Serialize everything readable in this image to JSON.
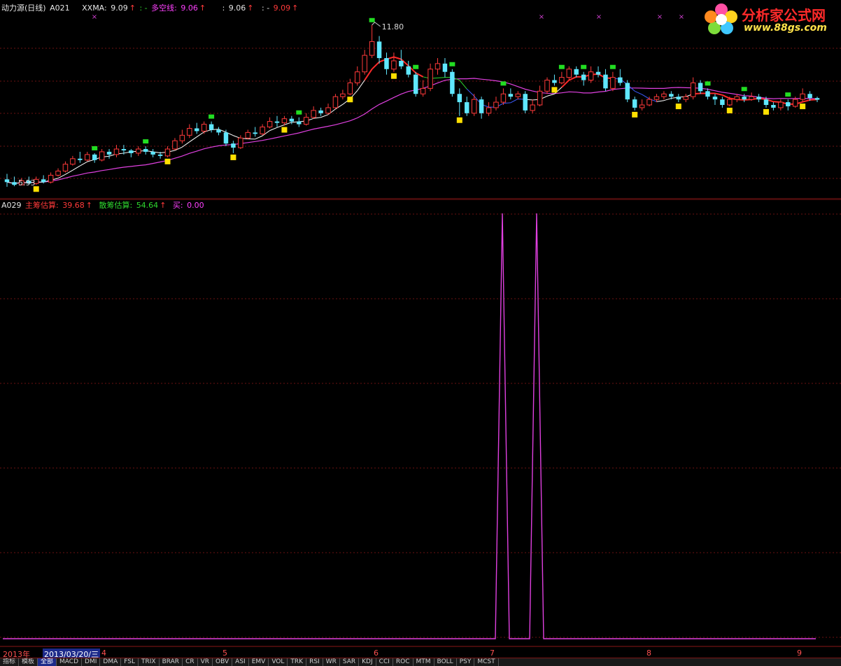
{
  "upper_panel": {
    "name": "动力源(日线)",
    "code": "A021",
    "xxma_label": "XXMA:",
    "xxma_value": "9.09",
    "sep1": ": -",
    "duokong_label": "多空线:",
    "duokong_value": "9.06",
    "val2_prefix": ":",
    "val2": "9.06",
    "val3_prefix": ": -",
    "val3": "9.09",
    "high_label": "11.80",
    "low_label": "5.93"
  },
  "lower_panel": {
    "code": "A029",
    "zhuchou_label": "主筹估算:",
    "zhuchou_value": "39.68",
    "sanchou_label": "散筹估算:",
    "sanchou_value": "54.64",
    "mai_label": "买:",
    "mai_value": "0.00"
  },
  "date_axis": {
    "year": "2013年",
    "current_date": "2013/03/20/三",
    "months": [
      "4",
      "5",
      "6",
      "7",
      "8",
      "9"
    ]
  },
  "bottom_tabs": [
    "指标",
    "模板",
    "全部",
    "MACD",
    "DMI",
    "DMA",
    "FSL",
    "TRIX",
    "BRAR",
    "CR",
    "VR",
    "OBV",
    "ASI",
    "EMV",
    "VOL",
    "TRK",
    "RSI",
    "WR",
    "SAR",
    "KDJ",
    "CCI",
    "ROC",
    "MTM",
    "BOLL",
    "PSY",
    "MCST"
  ],
  "logo": {
    "text": "分析家公式网",
    "url": "www.88gs.com"
  },
  "colors": {
    "up": "#ff3a3a",
    "down": "#5fe7ff",
    "ma_white": "#ffffff",
    "ma_magenta": "#e040e0",
    "grid": "#6b1212",
    "signal_buy": "#ffe000",
    "signal_sell": "#22dd22",
    "pulse": "#e040e0"
  },
  "chart_data": {
    "type": "candlestick",
    "price_range": [
      5.6,
      12.2
    ],
    "price_high": 11.8,
    "price_low": 5.93,
    "candles": [
      [
        6.2,
        6.1,
        6.4,
        5.93
      ],
      [
        6.1,
        6.0,
        6.3,
        5.95
      ],
      [
        6.0,
        6.15,
        6.25,
        5.98
      ],
      [
        6.15,
        6.05,
        6.3,
        6.0
      ],
      [
        6.05,
        6.2,
        6.3,
        6.0
      ],
      [
        6.2,
        6.1,
        6.35,
        6.05
      ],
      [
        6.1,
        6.35,
        6.45,
        6.05
      ],
      [
        6.35,
        6.5,
        6.6,
        6.3
      ],
      [
        6.5,
        6.75,
        6.85,
        6.45
      ],
      [
        6.75,
        6.95,
        7.05,
        6.7
      ],
      [
        6.95,
        6.9,
        7.2,
        6.8
      ],
      [
        6.9,
        7.1,
        7.2,
        6.85
      ],
      [
        7.1,
        6.9,
        7.15,
        6.8
      ],
      [
        6.9,
        7.2,
        7.3,
        6.85
      ],
      [
        7.2,
        7.1,
        7.3,
        6.95
      ],
      [
        7.1,
        7.3,
        7.45,
        7.0
      ],
      [
        7.3,
        7.25,
        7.45,
        7.1
      ],
      [
        7.25,
        7.15,
        7.3,
        7.0
      ],
      [
        7.15,
        7.3,
        7.4,
        7.05
      ],
      [
        7.3,
        7.2,
        7.4,
        7.1
      ],
      [
        7.2,
        7.1,
        7.3,
        7.0
      ],
      [
        7.1,
        7.05,
        7.2,
        6.95
      ],
      [
        7.05,
        7.3,
        7.4,
        7.0
      ],
      [
        7.3,
        7.6,
        7.7,
        7.25
      ],
      [
        7.6,
        7.8,
        8.0,
        7.5
      ],
      [
        7.8,
        8.05,
        8.2,
        7.7
      ],
      [
        8.05,
        7.95,
        8.25,
        7.85
      ],
      [
        7.95,
        8.2,
        8.3,
        7.85
      ],
      [
        8.2,
        8.0,
        8.3,
        7.9
      ],
      [
        8.0,
        7.9,
        8.1,
        7.8
      ],
      [
        7.9,
        7.5,
        8.0,
        7.4
      ],
      [
        7.5,
        7.35,
        7.6,
        7.15
      ],
      [
        7.35,
        7.7,
        7.8,
        7.3
      ],
      [
        7.7,
        7.9,
        8.0,
        7.65
      ],
      [
        7.9,
        7.85,
        8.1,
        7.75
      ],
      [
        7.85,
        8.1,
        8.2,
        7.8
      ],
      [
        8.1,
        8.3,
        8.45,
        8.05
      ],
      [
        8.3,
        8.25,
        8.5,
        8.1
      ],
      [
        8.25,
        8.4,
        8.5,
        8.15
      ],
      [
        8.4,
        8.3,
        8.5,
        8.2
      ],
      [
        8.3,
        8.2,
        8.45,
        8.1
      ],
      [
        8.2,
        8.45,
        8.6,
        8.15
      ],
      [
        8.45,
        8.7,
        8.85,
        8.4
      ],
      [
        8.7,
        8.6,
        8.8,
        8.5
      ],
      [
        8.6,
        8.8,
        8.95,
        8.55
      ],
      [
        8.8,
        9.2,
        9.3,
        8.75
      ],
      [
        9.2,
        9.3,
        9.45,
        9.1
      ],
      [
        9.3,
        9.7,
        9.85,
        9.25
      ],
      [
        9.7,
        10.1,
        10.3,
        9.6
      ],
      [
        10.1,
        10.7,
        10.9,
        10.0
      ],
      [
        10.7,
        11.2,
        11.8,
        10.6
      ],
      [
        11.2,
        10.6,
        11.4,
        10.4
      ],
      [
        10.6,
        10.2,
        10.8,
        10.0
      ],
      [
        10.2,
        10.5,
        10.8,
        10.1
      ],
      [
        10.5,
        10.3,
        10.9,
        10.2
      ],
      [
        10.3,
        10.0,
        10.5,
        9.9
      ],
      [
        10.0,
        9.3,
        10.1,
        9.2
      ],
      [
        9.3,
        9.5,
        9.8,
        9.2
      ],
      [
        9.5,
        10.2,
        10.4,
        9.4
      ],
      [
        10.2,
        10.4,
        10.6,
        10.0
      ],
      [
        10.4,
        10.1,
        10.6,
        9.9
      ],
      [
        10.1,
        9.3,
        10.2,
        9.2
      ],
      [
        9.3,
        9.0,
        9.5,
        8.5
      ],
      [
        9.0,
        8.6,
        9.2,
        8.5
      ],
      [
        8.6,
        9.1,
        9.3,
        8.5
      ],
      [
        9.1,
        8.6,
        9.2,
        8.4
      ],
      [
        8.6,
        8.8,
        9.0,
        8.5
      ],
      [
        8.8,
        9.0,
        9.2,
        8.7
      ],
      [
        9.0,
        9.3,
        9.5,
        8.9
      ],
      [
        9.3,
        9.2,
        9.5,
        9.1
      ],
      [
        9.2,
        9.3,
        9.4,
        9.1
      ],
      [
        9.3,
        8.7,
        9.4,
        8.6
      ],
      [
        8.7,
        8.9,
        9.1,
        8.6
      ],
      [
        8.9,
        9.4,
        9.6,
        8.85
      ],
      [
        9.4,
        9.8,
        9.9,
        9.3
      ],
      [
        9.8,
        9.7,
        10.0,
        9.6
      ],
      [
        9.7,
        9.9,
        10.1,
        9.65
      ],
      [
        9.9,
        10.2,
        10.3,
        9.8
      ],
      [
        10.2,
        10.0,
        10.3,
        9.9
      ],
      [
        10.0,
        9.8,
        10.1,
        9.6
      ],
      [
        9.8,
        10.1,
        10.3,
        9.7
      ],
      [
        10.1,
        10.0,
        10.3,
        9.9
      ],
      [
        10.0,
        9.5,
        10.2,
        9.4
      ],
      [
        9.5,
        9.9,
        10.1,
        9.4
      ],
      [
        9.9,
        9.7,
        10.2,
        9.6
      ],
      [
        9.7,
        9.1,
        9.8,
        9.0
      ],
      [
        9.1,
        8.8,
        9.2,
        8.7
      ],
      [
        8.8,
        8.9,
        9.1,
        8.7
      ],
      [
        8.9,
        9.1,
        9.2,
        8.85
      ],
      [
        9.1,
        9.2,
        9.3,
        9.0
      ],
      [
        9.2,
        9.3,
        9.4,
        9.1
      ],
      [
        9.3,
        9.2,
        9.4,
        9.1
      ],
      [
        9.2,
        9.1,
        9.3,
        9.0
      ],
      [
        9.1,
        9.2,
        9.3,
        9.0
      ],
      [
        9.2,
        9.7,
        9.9,
        9.1
      ],
      [
        9.7,
        9.4,
        9.8,
        9.3
      ],
      [
        9.4,
        9.2,
        9.5,
        9.1
      ],
      [
        9.2,
        9.1,
        9.3,
        8.9
      ],
      [
        9.1,
        8.9,
        9.2,
        8.8
      ],
      [
        8.9,
        9.1,
        9.2,
        8.85
      ],
      [
        9.1,
        9.2,
        9.3,
        9.0
      ],
      [
        9.2,
        9.1,
        9.3,
        9.0
      ],
      [
        9.1,
        9.2,
        9.35,
        9.05
      ],
      [
        9.2,
        9.1,
        9.3,
        9.0
      ],
      [
        9.1,
        8.9,
        9.2,
        8.8
      ],
      [
        8.9,
        8.8,
        9.0,
        8.7
      ],
      [
        8.8,
        9.0,
        9.1,
        8.7
      ],
      [
        9.0,
        8.85,
        9.1,
        8.7
      ],
      [
        8.85,
        9.1,
        9.2,
        8.8
      ],
      [
        9.1,
        9.3,
        9.5,
        9.0
      ],
      [
        9.3,
        9.15,
        9.4,
        9.05
      ],
      [
        9.15,
        9.09,
        9.2,
        9.0
      ]
    ]
  }
}
